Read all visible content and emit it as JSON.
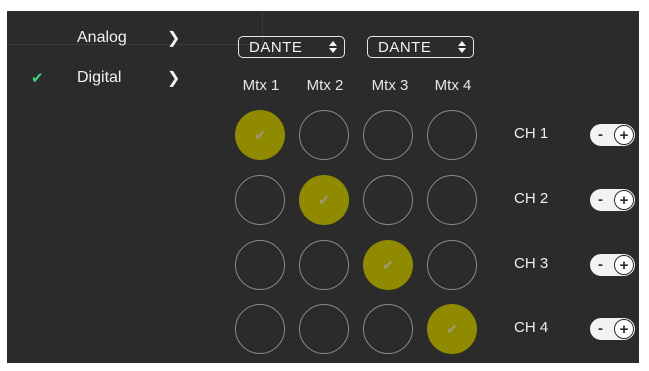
{
  "menu": [
    {
      "label": "Analog",
      "checked": false,
      "chevron": "chevron-right-icon"
    },
    {
      "label": "Digital",
      "checked": true,
      "chevron": "chevron-right-icon"
    }
  ],
  "check_glyph": "✔",
  "chevron_glyph": "❯",
  "selects": [
    {
      "value": "DANTE"
    },
    {
      "value": "DANTE"
    }
  ],
  "columns": [
    "Mtx 1",
    "Mtx 2",
    "Mtx 3",
    "Mtx 4"
  ],
  "rows": [
    {
      "label": "CH 1",
      "selected_column": 1
    },
    {
      "label": "CH 2",
      "selected_column": 2
    },
    {
      "label": "CH 3",
      "selected_column": 3
    },
    {
      "label": "CH 4",
      "selected_column": 4
    }
  ],
  "toggle": {
    "minus": "-",
    "plus": "+"
  },
  "colors": {
    "background": "#2b2b2b",
    "selected_fill": "#8f8a00",
    "check_accent": "#3fd47c",
    "ring": "#8a8a8a"
  }
}
